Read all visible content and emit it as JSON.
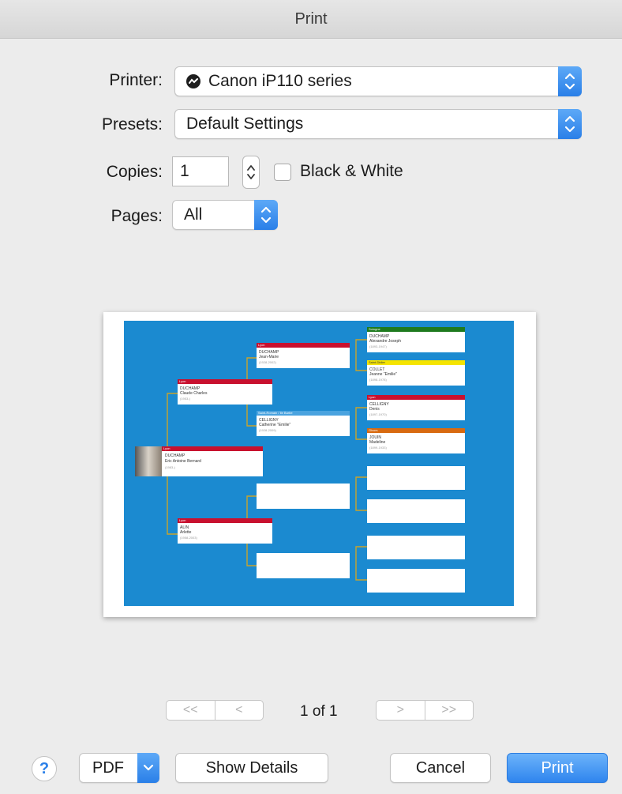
{
  "window": {
    "title": "Print"
  },
  "form": {
    "printer_label": "Printer:",
    "printer_value": "Canon iP110 series",
    "presets_label": "Presets:",
    "presets_value": "Default Settings",
    "copies_label": "Copies:",
    "copies_value": "1",
    "bw_label": "Black & White",
    "bw_checked": false,
    "pages_label": "Pages:",
    "pages_value": "All"
  },
  "preview": {
    "page_indicator": "1 of 1",
    "first_page_glyph": "<<",
    "prev_page_glyph": "<",
    "next_page_glyph": ">",
    "last_page_glyph": ">>",
    "tree": {
      "root": {
        "header": "Lyon",
        "name": "DUCHAMP",
        "given": "Eric Antoine Bernard",
        "years": "(1983-)"
      },
      "father": {
        "header": "Lyon",
        "name": "DUCHAMP",
        "given": "Claude Charles",
        "years": "(1953-)"
      },
      "mother": {
        "header": "Lyon",
        "name": "ALIN",
        "given": "Arlette",
        "years": "(1958-2003)"
      },
      "paternal_grandfather": {
        "header": "Lyon",
        "name": "DUCHAMP",
        "given": "Jean-Marie",
        "years": "(1928-2002)"
      },
      "paternal_grandmother": {
        "header": "Saint-Romain / Ile Barbe",
        "name": "CELLIGNY",
        "given": "Catherine \"Emilie\"",
        "years": "(1928-2009)"
      },
      "ggf_1": {
        "header": "Sologne",
        "name": "DUCHAMP",
        "given": "Alexandre Joseph",
        "years": "(1893-1947)"
      },
      "ggm_1": {
        "header": "Saint-Didier",
        "name": "COLLET",
        "given": "Jeanne \"Emilie\"",
        "years": "(1898-1978)"
      },
      "ggf_2": {
        "header": "Lyon",
        "name": "CELLIGNY",
        "given": "Denis",
        "years": "(1897-1970)"
      },
      "ggm_2": {
        "header": "Givors",
        "name": "JOUIN",
        "given": "Madeline",
        "years": "(1899-1933)"
      }
    }
  },
  "buttons": {
    "help": "?",
    "pdf": "PDF",
    "show_details": "Show Details",
    "cancel": "Cancel",
    "print": "Print"
  },
  "colors": {
    "accent": "#2f85ee",
    "tree_background": "#1b8ad0",
    "header_red": "#c8102e",
    "header_green": "#1e7a1e",
    "header_yellow": "#f5e400",
    "header_orange": "#d86a10",
    "header_blue": "#4aa3df",
    "connector": "#c9a32a"
  }
}
